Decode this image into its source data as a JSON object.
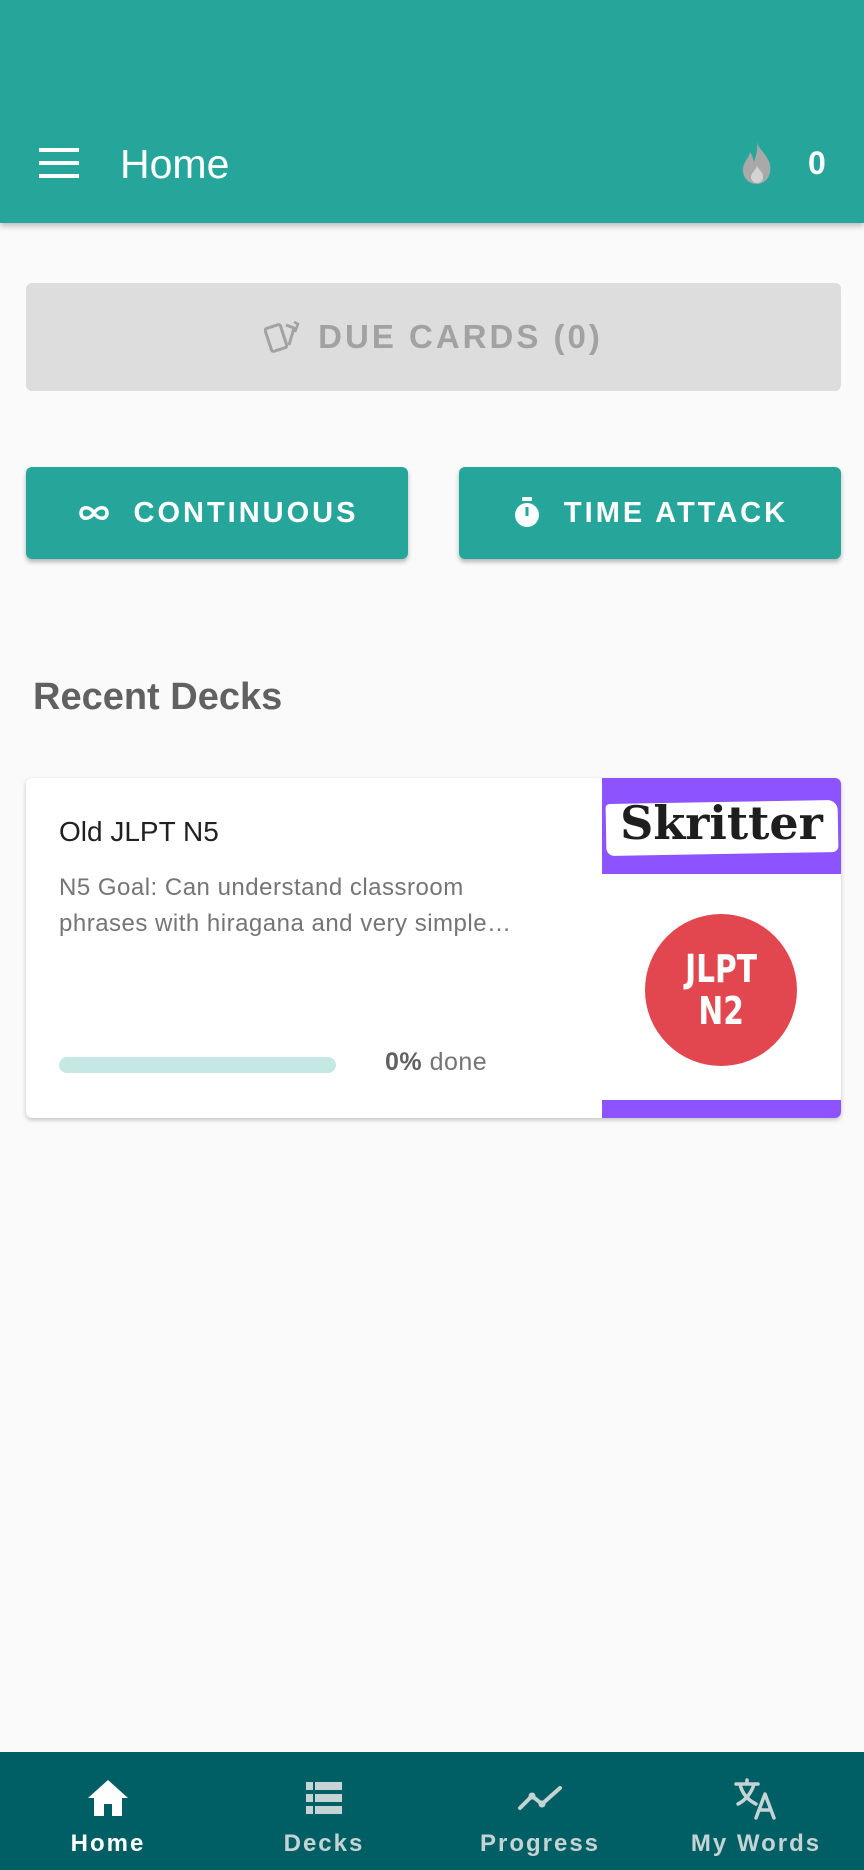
{
  "header": {
    "title": "Home",
    "menu_icon": "menu-icon",
    "streak_icon": "flame-icon",
    "streak_count": "0"
  },
  "due_cards": {
    "label": "DUE CARDS (0)",
    "icon": "cards-icon",
    "enabled": false
  },
  "modes": {
    "continuous": {
      "label": "CONTINUOUS",
      "icon": "infinity-icon"
    },
    "time_attack": {
      "label": "TIME ATTACK",
      "icon": "stopwatch-icon"
    }
  },
  "recent_decks": {
    "title": "Recent Decks",
    "decks": [
      {
        "name": "Old JLPT N5",
        "description": "N5 Goal: Can understand classroom phrases with hiragana and very simple…",
        "progress_percent": 0,
        "progress_value": "0%",
        "progress_suffix": " done",
        "image": {
          "brand": "Skritter",
          "badge_line1": "JLPT",
          "badge_line2": "N2"
        }
      }
    ]
  },
  "bottom_nav": {
    "items": [
      {
        "label": "Home",
        "icon": "home-icon",
        "active": true
      },
      {
        "label": "Decks",
        "icon": "list-icon",
        "active": false
      },
      {
        "label": "Progress",
        "icon": "trend-icon",
        "active": false
      },
      {
        "label": "My Words",
        "icon": "translate-icon",
        "active": false
      }
    ]
  },
  "colors": {
    "primary": "#26a69a",
    "nav_background": "#005f64",
    "badge_red": "#e2464f",
    "brand_purple": "#8c53ff"
  }
}
